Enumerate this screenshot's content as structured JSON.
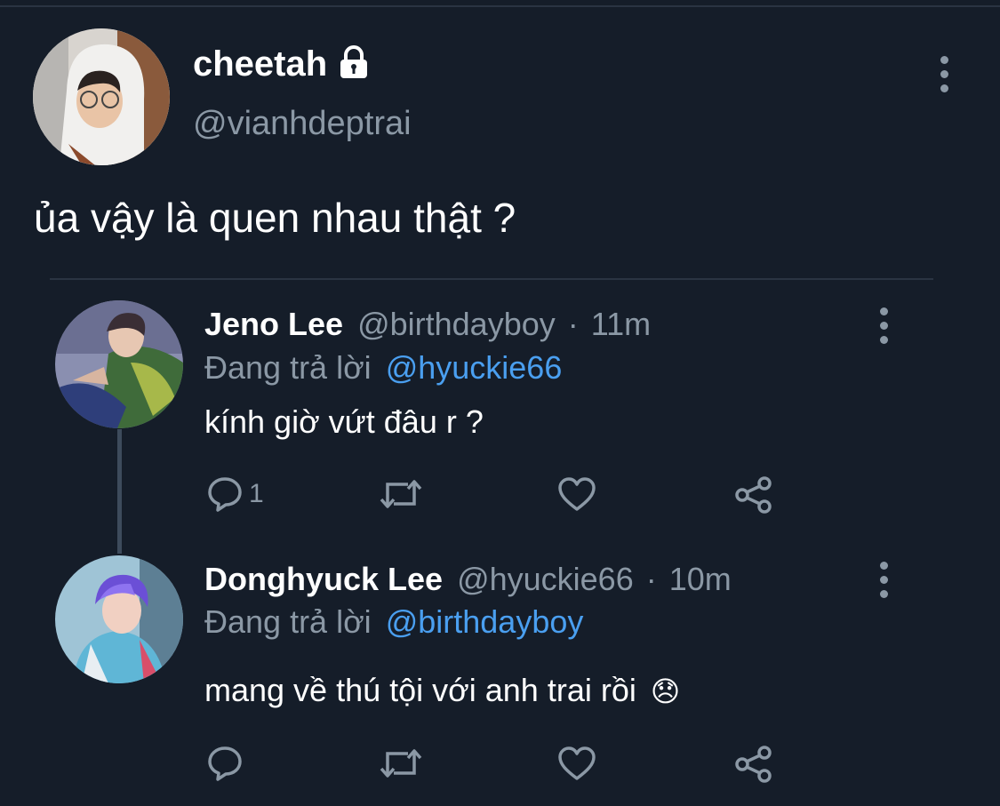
{
  "main_tweet": {
    "display_name": "cheetah",
    "handle": "@vianhdeptrai",
    "text": "ủa vậy là quen nhau thật ?",
    "avatar_icon": "avatar-person-hoodie",
    "lock_icon": "lock-icon"
  },
  "replies": [
    {
      "display_name": "Jeno Lee",
      "handle": "@birthdayboy",
      "separator": "·",
      "time": "11m",
      "replying_label": "Đang trả lời",
      "replying_to": "@hyuckie66",
      "text": "kính giờ vứt đâu r ?",
      "reply_count": "1",
      "avatar_icon": "avatar-person-green-jacket"
    },
    {
      "display_name": "Donghyuck Lee",
      "handle": "@hyuckie66",
      "separator": "·",
      "time": "10m",
      "replying_label": "Đang trả lời",
      "replying_to": "@birthdayboy",
      "text": "mang về thú tội với anh trai rồi",
      "emoji": "😞",
      "reply_count": "",
      "avatar_icon": "avatar-person-purple-hair"
    }
  ],
  "colors": {
    "background": "#151d29",
    "text": "#ffffff",
    "muted": "#8b98a5",
    "link": "#4a9ff0",
    "thread_line": "#3d4b5c"
  }
}
